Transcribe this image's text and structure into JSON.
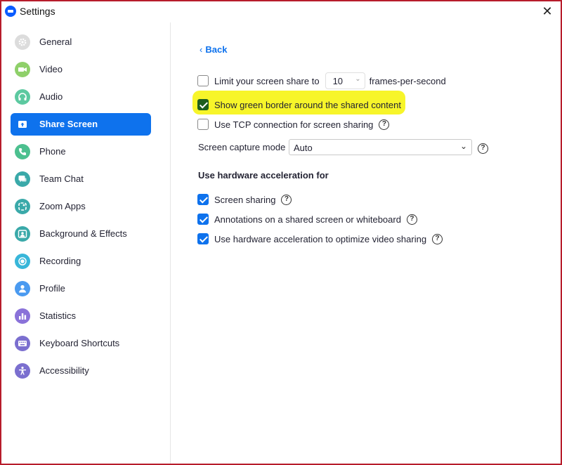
{
  "window": {
    "title": "Settings"
  },
  "sidebar": {
    "items": [
      {
        "label": "General",
        "icon": "gear-icon",
        "color": "#dcdcdc",
        "active": false
      },
      {
        "label": "Video",
        "icon": "video-camera-icon",
        "color": "#8fd06a",
        "active": false
      },
      {
        "label": "Audio",
        "icon": "headphones-icon",
        "color": "#5cc9a0",
        "active": false
      },
      {
        "label": "Share Screen",
        "icon": "share-screen-icon",
        "color": "#0e72ed",
        "active": true
      },
      {
        "label": "Phone",
        "icon": "phone-icon",
        "color": "#4cc08f",
        "active": false
      },
      {
        "label": "Team Chat",
        "icon": "chat-icon",
        "color": "#3aa9a9",
        "active": false
      },
      {
        "label": "Zoom Apps",
        "icon": "apps-icon",
        "color": "#3aa9a9",
        "active": false
      },
      {
        "label": "Background & Effects",
        "icon": "background-icon",
        "color": "#3aa9a9",
        "active": false
      },
      {
        "label": "Recording",
        "icon": "record-icon",
        "color": "#38b6d9",
        "active": false
      },
      {
        "label": "Profile",
        "icon": "person-icon",
        "color": "#4a9af0",
        "active": false
      },
      {
        "label": "Statistics",
        "icon": "bar-chart-icon",
        "color": "#8a72d9",
        "active": false
      },
      {
        "label": "Keyboard Shortcuts",
        "icon": "keyboard-icon",
        "color": "#7b6fcf",
        "active": false
      },
      {
        "label": "Accessibility",
        "icon": "accessibility-icon",
        "color": "#7b6fcf",
        "active": false
      }
    ]
  },
  "main": {
    "back_label": "Back",
    "limit": {
      "label": "Limit your screen share to",
      "fps": "10",
      "suffix": "frames-per-second",
      "checked": false
    },
    "green_border": {
      "label": "Show green border around the shared content",
      "checked": true
    },
    "tcp": {
      "label": "Use TCP connection for screen sharing",
      "checked": false
    },
    "capture_mode": {
      "label": "Screen capture mode",
      "value": "Auto"
    },
    "hw_section_title": "Use hardware acceleration for",
    "hw_options": [
      {
        "label": "Screen sharing",
        "checked": true
      },
      {
        "label": "Annotations on a shared screen or whiteboard",
        "checked": true
      },
      {
        "label": "Use hardware acceleration to optimize video sharing",
        "checked": true
      }
    ],
    "help_glyph": "?"
  },
  "colors": {
    "accent": "#0e72ed",
    "highlight": "#f7f52a",
    "window_border": "#b71c2b"
  }
}
